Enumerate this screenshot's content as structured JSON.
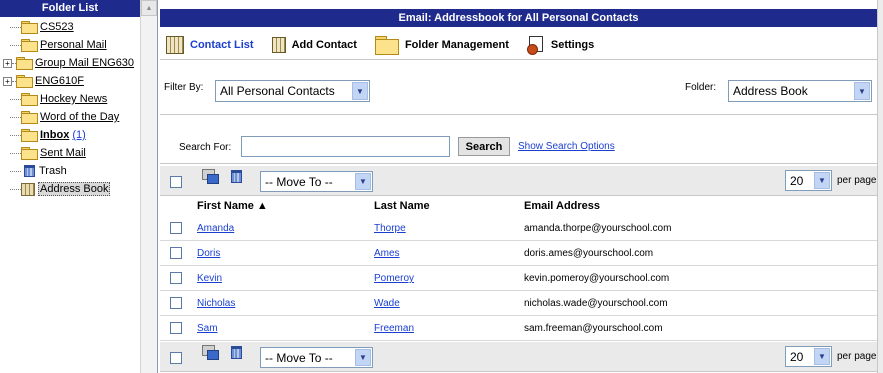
{
  "folder_list": {
    "title": "Folder List",
    "folders": [
      {
        "name": "CS523",
        "expandable": false,
        "bold": false
      },
      {
        "name": "Personal Mail",
        "expandable": false,
        "bold": false
      },
      {
        "name": "Group Mail ENG630",
        "expandable": true,
        "bold": false
      },
      {
        "name": "ENG610F",
        "expandable": true,
        "bold": false
      },
      {
        "name": "Hockey News",
        "expandable": false,
        "bold": false
      },
      {
        "name": "Word of the Day",
        "expandable": false,
        "bold": false
      },
      {
        "name": "Inbox",
        "count": "(1)",
        "expandable": false,
        "bold": true
      },
      {
        "name": "Sent Mail",
        "expandable": false,
        "bold": false
      },
      {
        "name": "Trash",
        "icon": "trash-icon",
        "expandable": false,
        "bold": false
      },
      {
        "name": "Address Book",
        "icon": "address-book-icon",
        "selected": true,
        "expandable": false,
        "bold": false
      }
    ]
  },
  "main": {
    "title": "Email: Addressbook for All Personal Contacts",
    "toolbar": {
      "contact_list": "Contact List",
      "add_contact": "Add Contact",
      "folder_management": "Folder Management",
      "settings": "Settings"
    },
    "filter": {
      "label": "Filter By:",
      "value": "All Personal Contacts",
      "folder_label": "Folder:",
      "folder_value": "Address Book"
    },
    "search": {
      "label": "Search For:",
      "value": "",
      "button": "Search",
      "options_link": "Show Search Options"
    },
    "actions": {
      "move_to": "-- Move To --",
      "per_page_value": "20",
      "per_page_label": "per page"
    },
    "columns": {
      "first_name": "First Name ▲",
      "last_name": "Last Name",
      "email": "Email Address"
    },
    "contacts": [
      {
        "first": "Amanda",
        "last": "Thorpe",
        "email": "amanda.thorpe@yourschool.com"
      },
      {
        "first": "Doris",
        "last": "Ames",
        "email": "doris.ames@yourschool.com"
      },
      {
        "first": "Kevin",
        "last": "Pomeroy",
        "email": "kevin.pomeroy@yourschool.com"
      },
      {
        "first": "Nicholas",
        "last": "Wade",
        "email": "nicholas.wade@yourschool.com"
      },
      {
        "first": "Sam",
        "last": "Freeman",
        "email": "sam.freeman@yourschool.com"
      }
    ]
  },
  "colors": {
    "header_bg": "#1f2b8c",
    "link": "#1a3fd1"
  }
}
